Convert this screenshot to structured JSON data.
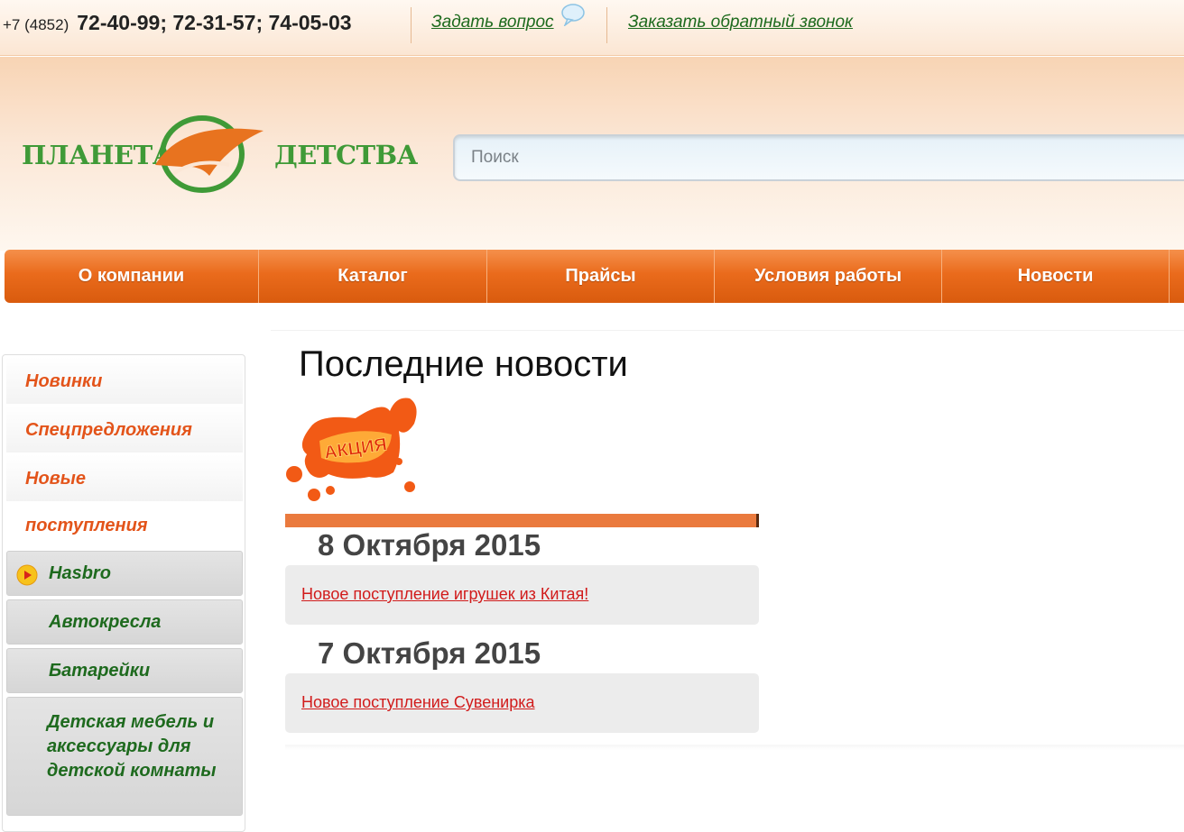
{
  "topbar": {
    "phone_code": "+7 (4852)",
    "phone_numbers": "72-40-99; 72-31-57; 74-05-03",
    "ask_question": "Задать вопрос",
    "callback": "Заказать обратный звонок"
  },
  "header": {
    "logo_left": "ПЛАНЕТА",
    "logo_right": "ДЕТСТВА",
    "search_placeholder": "Поиск"
  },
  "nav": [
    {
      "label": "О компании"
    },
    {
      "label": "Каталог"
    },
    {
      "label": "Прайсы"
    },
    {
      "label": "Условия работы"
    },
    {
      "label": "Новости"
    }
  ],
  "sidebar": {
    "orange_items": [
      "Новинки",
      "Спецпредложения",
      "Новые",
      "поступления"
    ],
    "green_items": [
      "Hasbro",
      "Автокресла",
      "Батарейки",
      "Детская мебель и аксессуары для детской комнаты"
    ]
  },
  "content": {
    "title": "Последние новости",
    "badge_text": "АКЦИЯ",
    "news": [
      {
        "date": "8 Октября 2015",
        "link": "Новое поступление игрушек из Китая!"
      },
      {
        "date": "7 Октября 2015",
        "link": "Новое поступление Сувенирка"
      }
    ]
  },
  "colors": {
    "accent_orange": "#ea6b1c",
    "green": "#1e6a1e",
    "news_link": "#d11b1b"
  }
}
